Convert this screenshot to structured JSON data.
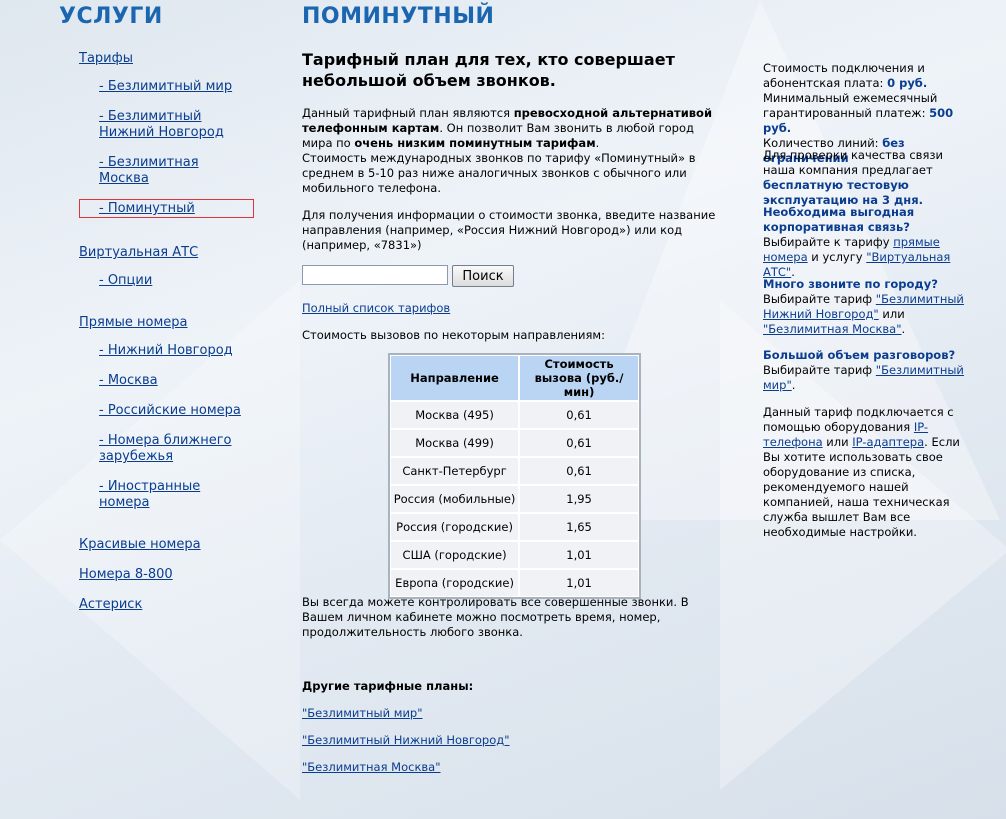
{
  "services": {
    "title": "УСЛУГИ",
    "nav": [
      {
        "label": "Тарифы",
        "level": "top"
      },
      {
        "label": "- Безлимитный мир",
        "level": "sub"
      },
      {
        "label": "- Безлимитный Нижний Новгород",
        "level": "sub"
      },
      {
        "label": "- Безлимитная Москва",
        "level": "sub"
      },
      {
        "label": "- Поминутный",
        "level": "sub",
        "current": true
      },
      {
        "label": "Виртуальная АТС",
        "level": "top"
      },
      {
        "label": "- Опции",
        "level": "sub"
      },
      {
        "label": "Прямые номера",
        "level": "top"
      },
      {
        "label": "- Нижний Новгород",
        "level": "sub"
      },
      {
        "label": "- Москва",
        "level": "sub"
      },
      {
        "label": "- Российские номера",
        "level": "sub"
      },
      {
        "label": "- Номера ближнего зарубежья",
        "level": "sub"
      },
      {
        "label": "- Иностранные номера",
        "level": "sub"
      },
      {
        "label": "Красивые номера",
        "level": "top"
      },
      {
        "label": "Номера 8-800",
        "level": "top"
      },
      {
        "label": "Астериск",
        "level": "top"
      }
    ]
  },
  "main": {
    "title": "ПОМИНУТНЫЙ",
    "heading": "Тарифный план для тех, кто совершает небольшой объем звонков.",
    "intro": {
      "t1": "Данный тарифный план являются ",
      "b1": "превосходной альтернативой телефонным картам",
      "t2": ". Он позволит Вам звонить в любой город мира по ",
      "b2": "очень низким поминутным тарифам",
      "t3": ".",
      "t4": "Стоимость международных звонков по тарифу «Поминутный» в среднем в 5-10 раз ниже аналогичных звонков с обычного или мобильного телефона."
    },
    "search_hint": "Для получения информации о стоимости звонка, введите название направления (например, «Россия Нижний Новгород») или код (например, «7831»)",
    "search": {
      "value": "",
      "placeholder": "",
      "button": "Поиск"
    },
    "full_list_link": "Полный список тарифов",
    "table_caption": "Стоимость вызовов по некоторым направлениям:",
    "table": {
      "headers": [
        "Направление",
        "Стоимость вызова (руб./мин)"
      ],
      "rows": [
        [
          "Москва (495)",
          "0,61"
        ],
        [
          "Москва (499)",
          "0,61"
        ],
        [
          "Санкт-Петербург",
          "0,61"
        ],
        [
          "Россия (мобильные)",
          "1,95"
        ],
        [
          "Россия (городские)",
          "1,65"
        ],
        [
          "США (городские)",
          "1,01"
        ],
        [
          "Европа (городские)",
          "1,01"
        ]
      ]
    },
    "control_text": "Вы всегда можете контролировать все совершенные звонки. В Вашем личном кабинете можно посмотреть время, номер, продолжительность любого звонка.",
    "other_title": "Другие тарифные планы:",
    "other_links": [
      "\"Безлимитный мир\"",
      "\"Безлимитный Нижний Новгород\"",
      "\"Безлимитная Москва\""
    ]
  },
  "sidebar": {
    "b1": {
      "t1": "Стоимость подключения и абонентская плата: ",
      "v1": "0 руб.",
      "t2": "Минимальный ежемесячный гарантированный платеж: ",
      "v2": "500 руб.",
      "t3": "Количество линий: ",
      "v3": "без ограничений"
    },
    "b2": {
      "t1": "Для проверки качества связи наша компания предлагает ",
      "v1": "бесплатную тестовую эксплуатацию на 3 дня."
    },
    "b3": {
      "q": "Необходима выгодная корпоративная связь?",
      "t1": " Выбирайте к тарифу ",
      "l1": "прямые номера",
      "t2": " и услугу ",
      "l2": "\"Виртуальная АТС\"",
      "t3": "."
    },
    "b4": {
      "q": "Много звоните по городу?",
      "t1": "Выбирайте тариф ",
      "l1": "\"Безлимитный Нижний Новгород\"",
      "t2": " или ",
      "l2": "\"Безлимитная Москва\"",
      "t3": "."
    },
    "b5": {
      "q": "Большой объем разговоров?",
      "t1": "Выбирайте тариф ",
      "l1": "\"Безлимитный мир\"",
      "t2": "."
    },
    "b6": {
      "t1": "Данный тариф подключается с помощью оборудования ",
      "l1": "IP-телефона",
      "t2": " или ",
      "l2": "IP-адаптера",
      "t3": ". Если Вы хотите использовать свое оборудование из списка, рекомендуемого нашей компанией, наша техническая служба вышлет Вам все необходимые настройки."
    }
  },
  "colors": {
    "title_blue": "#1a66b0",
    "link_blue": "#0a3d8f",
    "current_border": "#e0343c",
    "table_header": "#b9d5f3"
  }
}
